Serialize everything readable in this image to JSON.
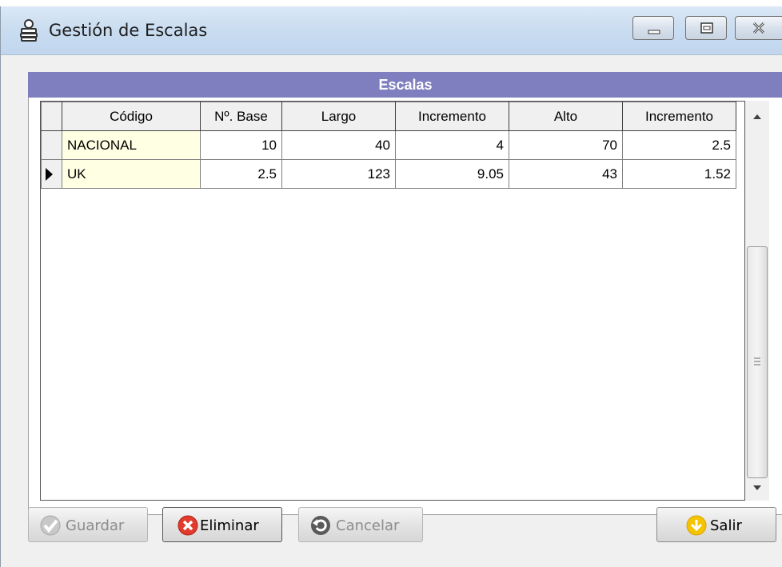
{
  "window": {
    "title": "Gestión de Escalas"
  },
  "panel": {
    "header": "Escalas"
  },
  "grid": {
    "columns": [
      "Código",
      "Nº. Base",
      "Largo",
      "Incremento",
      "Alto",
      "Incremento"
    ],
    "rows": [
      [
        "NACIONAL",
        "10",
        "40",
        "4",
        "70",
        "2.5"
      ],
      [
        "UK",
        "2.5",
        "123",
        "9.05",
        "43",
        "1.52"
      ]
    ],
    "current_row": 1
  },
  "buttons": {
    "guardar": "Guardar",
    "eliminar": "Eliminar",
    "cancelar": "Cancelar",
    "salir": "Salir"
  },
  "icons": {
    "app": "user-stack-icon",
    "guardar": "checkmark-icon",
    "eliminar": "red-x-icon",
    "cancelar": "undo-icon",
    "salir": "down-arrow-icon"
  },
  "colors": {
    "panel_header": "#7f7fc0",
    "code_cell": "#ffffe4",
    "eliminar_icon": "#e23b2e",
    "salir_icon": "#f5c400"
  }
}
